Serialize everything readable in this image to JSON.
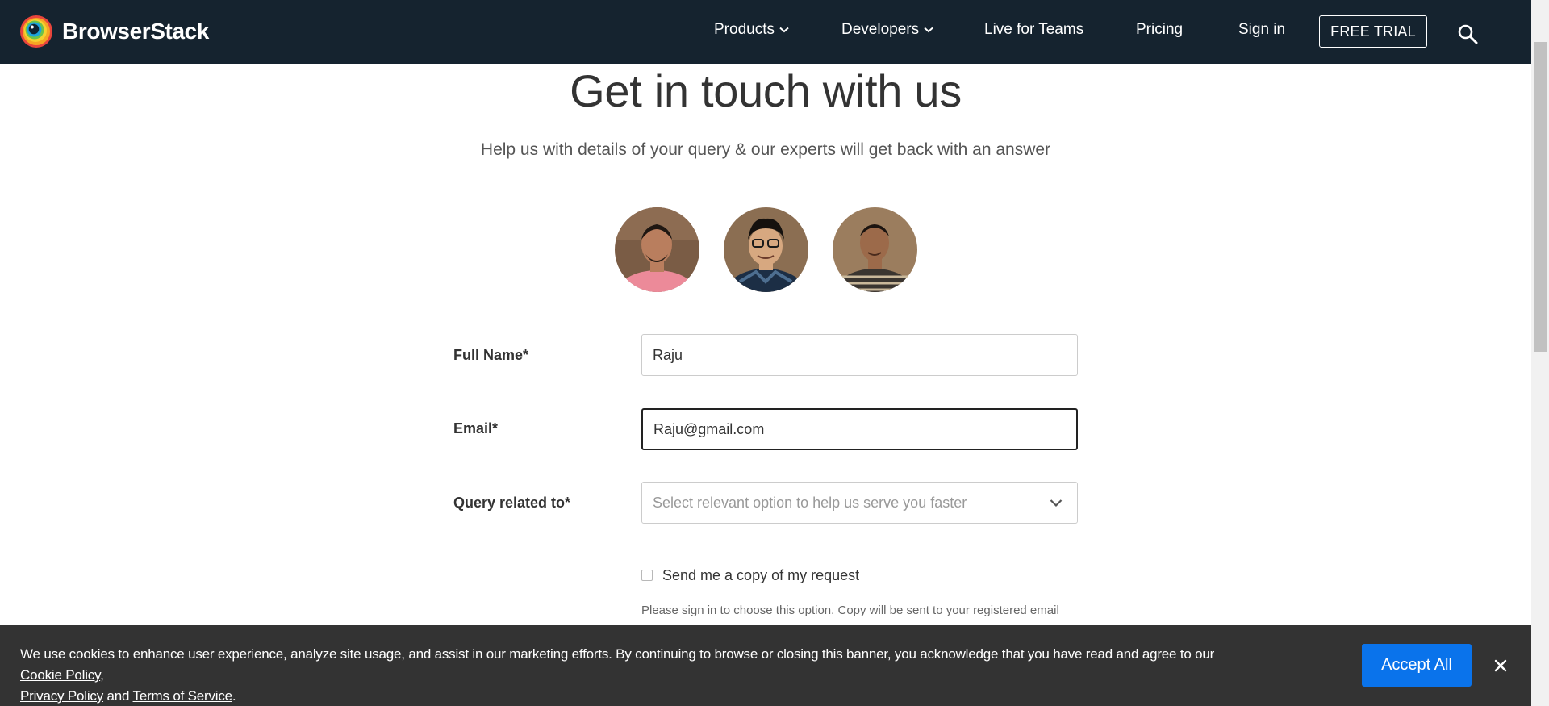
{
  "header": {
    "brand_name": "BrowserStack",
    "nav": {
      "products": "Products",
      "developers": "Developers",
      "live_for_teams": "Live for Teams",
      "pricing": "Pricing",
      "sign_in": "Sign in"
    },
    "free_trial": "FREE TRIAL",
    "icons": [
      "browserstack-logo-icon",
      "chevron-down-icon",
      "search-icon"
    ],
    "colors": {
      "nav_bg": "#15232f",
      "text": "#ffffff"
    }
  },
  "main": {
    "title": "Get in touch with us",
    "subtitle": "Help us with details of your query & our experts will get back with an answer",
    "form": {
      "full_name_label": "Full Name*",
      "full_name_value": "Raju",
      "email_label": "Email*",
      "email_value": "Raju@gmail.com",
      "query_label": "Query related to*",
      "query_placeholder": "Select relevant option to help us serve you faster",
      "copy_checkbox_label": "Send me a copy of my request",
      "copy_checkbox_checked": false,
      "copy_help_text": "Please sign in to choose this option. Copy will be sent to your registered email"
    }
  },
  "cookie_banner": {
    "text_before": "We use cookies to enhance user experience, analyze site usage, and assist in our marketing efforts. By continuing to browse or closing this banner, you acknowledge that you have read and agree to our ",
    "cookie_policy": "Cookie Policy",
    "comma": ",",
    "privacy_policy": "Privacy Policy",
    "and": " and ",
    "terms_of_service": "Terms of Service",
    "period": ".",
    "accept_all": "Accept All",
    "close_icon": "close-icon",
    "colors": {
      "bg": "#333333",
      "accept_bg": "#0a73eb"
    }
  }
}
